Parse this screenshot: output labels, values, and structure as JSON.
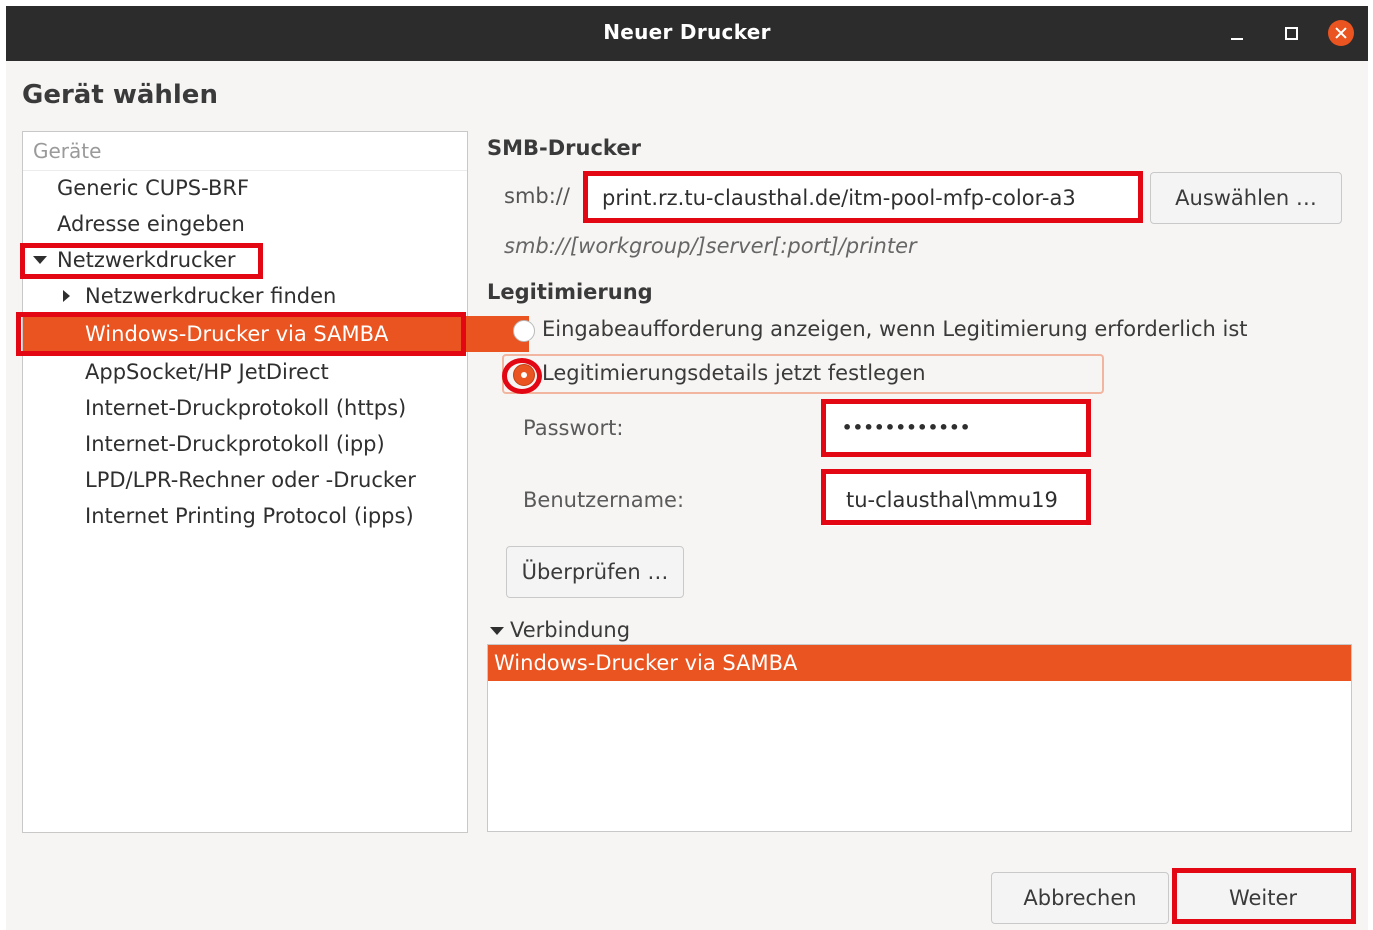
{
  "window": {
    "title": "Neuer Drucker",
    "controls": {
      "minimize": "minimize-icon",
      "maximize": "maximize-icon",
      "close": "close-icon"
    },
    "accent_color": "#e95420",
    "highlight_color": "#e30613"
  },
  "page": {
    "heading": "Gerät wählen"
  },
  "devices": {
    "column_header": "Geräte",
    "items": [
      {
        "label": "Generic CUPS-BRF"
      },
      {
        "label": "Adresse eingeben"
      },
      {
        "label": "Netzwerkdrucker",
        "expanded": true
      },
      {
        "label": "Netzwerkdrucker finden",
        "expanded": false
      },
      {
        "label": "Windows-Drucker via SAMBA",
        "selected": true
      },
      {
        "label": "AppSocket/HP JetDirect"
      },
      {
        "label": "Internet-Druckprotokoll (https)"
      },
      {
        "label": "Internet-Druckprotokoll (ipp)"
      },
      {
        "label": "LPD/LPR-Rechner oder -Drucker"
      },
      {
        "label": "Internet Printing Protocol (ipps)"
      }
    ]
  },
  "smb": {
    "section_label": "SMB-Drucker",
    "prefix": "smb://",
    "uri_value": "print.rz.tu-clausthal.de/itm-pool-mfp-color-a3",
    "browse_button": "Auswählen …",
    "hint": "smb://[workgroup/]server[:port]/printer"
  },
  "auth": {
    "section_label": "Legitimierung",
    "option_prompt": "Eingabeaufforderung anzeigen, wenn Legitimierung erforderlich ist",
    "option_set_now": "Legitimierungsdetails jetzt festlegen",
    "selected_option": "set_now",
    "password_label": "Passwort:",
    "password_value": "••••••••••••",
    "username_label": "Benutzername:",
    "username_value": "tu-clausthal\\mmu19",
    "verify_button": "Überprüfen …"
  },
  "connection": {
    "label": "Verbindung",
    "items": [
      {
        "label": "Windows-Drucker via SAMBA",
        "selected": true
      }
    ]
  },
  "footer": {
    "cancel_button": "Abbrechen",
    "next_button": "Weiter"
  }
}
